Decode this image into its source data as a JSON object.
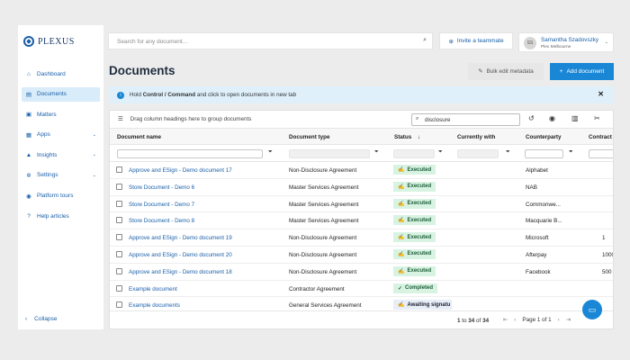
{
  "brand": {
    "name": "PLEXUS",
    "color": "#1a5fa8"
  },
  "sidebar": {
    "items": [
      {
        "label": "Dashboard",
        "icon": "home-icon",
        "glyph": "⌂",
        "chevron": false
      },
      {
        "label": "Documents",
        "icon": "document-icon",
        "glyph": "▤",
        "chevron": false,
        "active": true
      },
      {
        "label": "Matters",
        "icon": "briefcase-icon",
        "glyph": "▣",
        "chevron": false
      },
      {
        "label": "Apps",
        "icon": "grid-icon",
        "glyph": "▦",
        "chevron": true
      },
      {
        "label": "Insights",
        "icon": "chart-icon",
        "glyph": "▲",
        "chevron": true
      },
      {
        "label": "Settings",
        "icon": "gear-icon",
        "glyph": "✲",
        "chevron": true
      },
      {
        "label": "Platform tours",
        "icon": "compass-icon",
        "glyph": "◉",
        "chevron": false
      },
      {
        "label": "Help articles",
        "icon": "help-icon",
        "glyph": "?",
        "chevron": false
      }
    ],
    "collapse_label": "Collapse"
  },
  "topbar": {
    "search_placeholder": "Search for any document...",
    "invite_label": "Invite a teammate",
    "user": {
      "initials": "SS",
      "name": "Samantha Szadovszky",
      "org": "Plex Melbourne"
    }
  },
  "page": {
    "title": "Documents",
    "bulk_edit_label": "Bulk edit metadata",
    "add_label": "Add document"
  },
  "banner": {
    "pre": "Hold ",
    "bold": "Control / Command",
    "post": " and click to open documents in new tab"
  },
  "grid": {
    "group_hint": "Drag column headings here to group documents",
    "search_value": "disclosure",
    "columns": [
      "Document name",
      "Document type",
      "Status",
      "Currently with",
      "Counterparty",
      "Contract"
    ],
    "rows": [
      {
        "name": "Approve and ESign - Demo document 17",
        "type": "Non-Disclosure Agreement",
        "status": "Executed",
        "status_kind": "executed",
        "counterparty": "Alphabet",
        "contract": ""
      },
      {
        "name": "Store Document - Demo 6",
        "type": "Master Services Agreement",
        "status": "Executed",
        "status_kind": "executed",
        "counterparty": "NAB",
        "contract": ""
      },
      {
        "name": "Store Document - Demo 7",
        "type": "Master Services Agreement",
        "status": "Executed",
        "status_kind": "executed",
        "counterparty": "Commonwe...",
        "contract": ""
      },
      {
        "name": "Store Document - Demo 8",
        "type": "Master Services Agreement",
        "status": "Executed",
        "status_kind": "executed",
        "counterparty": "Macquarie B...",
        "contract": ""
      },
      {
        "name": "Approve and ESign - Demo document 19",
        "type": "Non-Disclosure Agreement",
        "status": "Executed",
        "status_kind": "executed",
        "counterparty": "Microsoft",
        "contract": "1"
      },
      {
        "name": "Approve and ESign - Demo document 20",
        "type": "Non-Disclosure Agreement",
        "status": "Executed",
        "status_kind": "executed",
        "counterparty": "Afterpay",
        "contract": "1000"
      },
      {
        "name": "Approve and ESign - Demo document 18",
        "type": "Non-Disclosure Agreement",
        "status": "Executed",
        "status_kind": "executed",
        "counterparty": "Facebook",
        "contract": "500"
      },
      {
        "name": "Example document",
        "type": "Contractor Agreement",
        "status": "Completed",
        "status_kind": "completed",
        "counterparty": "",
        "contract": ""
      },
      {
        "name": "Example documents",
        "type": "General Services Agreement",
        "status": "Awaiting signatu",
        "status_kind": "awaiting",
        "counterparty": "",
        "contract": ""
      }
    ],
    "footer": {
      "from": "1",
      "to_word": "to",
      "to": "34",
      "of_word": "of",
      "total": "34",
      "page_word": "Page",
      "page": "1",
      "pages": "1"
    }
  },
  "colors": {
    "accent": "#1a87d6",
    "executed_bg": "#d8f3e2",
    "banner_bg": "#dff0fb"
  }
}
